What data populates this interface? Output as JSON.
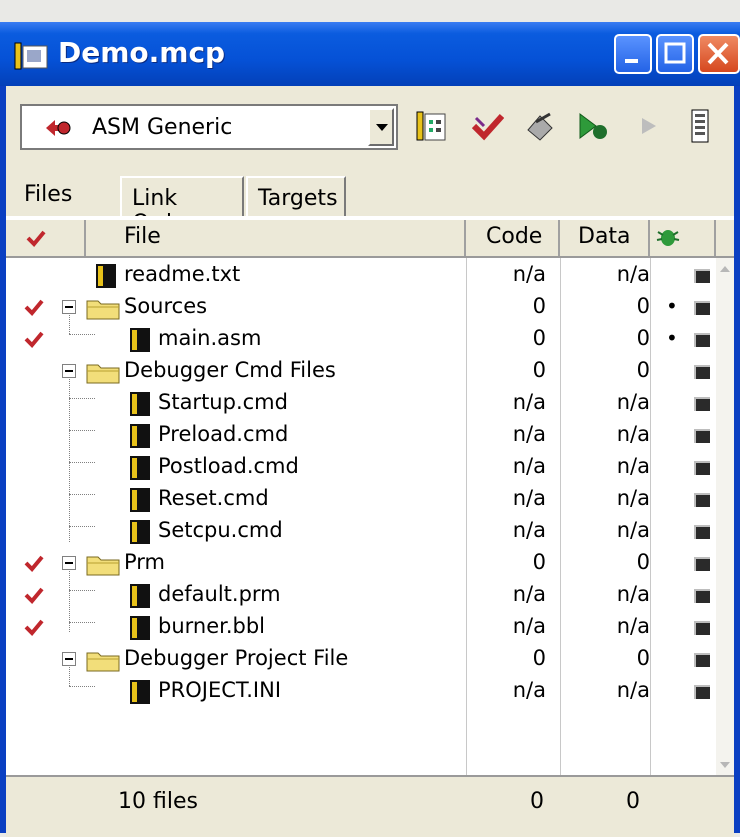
{
  "window": {
    "title": "Demo.mcp"
  },
  "toolbar": {
    "target": "ASM Generic"
  },
  "tabs": [
    {
      "label": "Files"
    },
    {
      "label": "Link Order"
    },
    {
      "label": "Targets"
    }
  ],
  "columns": {
    "file": "File",
    "code": "Code",
    "data": "Data"
  },
  "rows": [
    {
      "name": "readme.txt",
      "code": "n/a",
      "data": "n/a"
    },
    {
      "name": "Sources",
      "code": "0",
      "data": "0"
    },
    {
      "name": "main.asm",
      "code": "0",
      "data": "0"
    },
    {
      "name": "Debugger Cmd Files",
      "code": "0",
      "data": "0"
    },
    {
      "name": "Startup.cmd",
      "code": "n/a",
      "data": "n/a"
    },
    {
      "name": "Preload.cmd",
      "code": "n/a",
      "data": "n/a"
    },
    {
      "name": "Postload.cmd",
      "code": "n/a",
      "data": "n/a"
    },
    {
      "name": "Reset.cmd",
      "code": "n/a",
      "data": "n/a"
    },
    {
      "name": "Setcpu.cmd",
      "code": "n/a",
      "data": "n/a"
    },
    {
      "name": "Prm",
      "code": "0",
      "data": "0"
    },
    {
      "name": "default.prm",
      "code": "n/a",
      "data": "n/a"
    },
    {
      "name": "burner.bbl",
      "code": "n/a",
      "data": "n/a"
    },
    {
      "name": "Debugger Project File",
      "code": "0",
      "data": "0"
    },
    {
      "name": "PROJECT.INI",
      "code": "n/a",
      "data": "n/a"
    }
  ],
  "status": {
    "files": "10 files",
    "code_total": "0",
    "data_total": "0"
  },
  "colors": {
    "titlebar": "#0551d6",
    "check": "#c0272d",
    "face": "#ece9d8"
  }
}
